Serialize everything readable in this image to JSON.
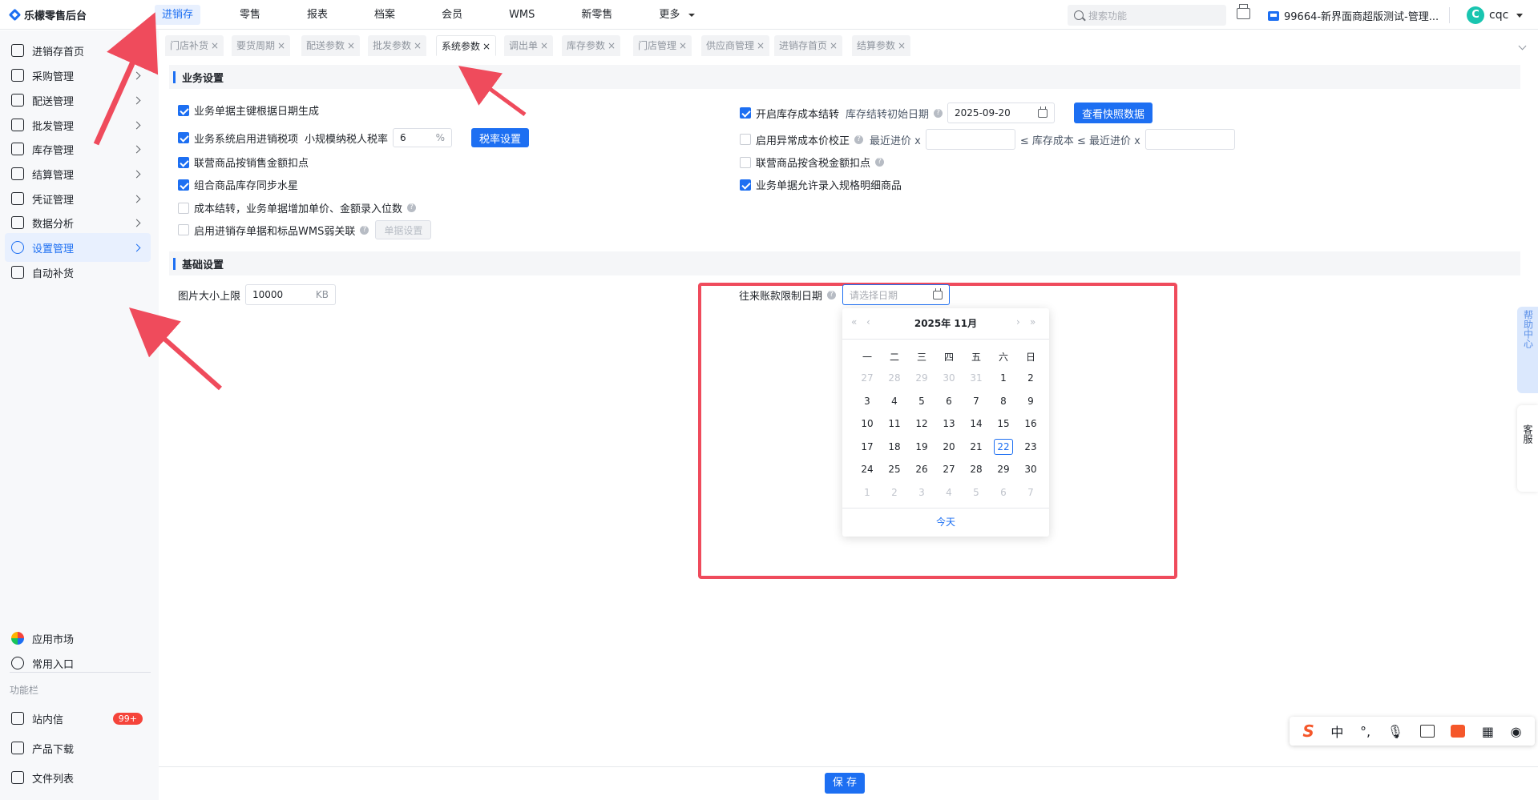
{
  "app": {
    "logo_text": "乐檬零售后台"
  },
  "topnav": [
    {
      "label": "进销存",
      "active": true
    },
    {
      "label": "零售"
    },
    {
      "label": "报表"
    },
    {
      "label": "档案"
    },
    {
      "label": "会员"
    },
    {
      "label": "WMS"
    },
    {
      "label": "新零售"
    },
    {
      "label": "更多"
    }
  ],
  "header": {
    "search_placeholder": "搜索功能",
    "store_name": "99664-新界面商超版测试-管理...",
    "user_initial": "C",
    "user_name": "cqc"
  },
  "sidebar": {
    "items": [
      {
        "label": "进销存首页",
        "icon": "home-icon"
      },
      {
        "label": "采购管理",
        "icon": "cart-icon"
      },
      {
        "label": "配送管理",
        "icon": "truck-icon"
      },
      {
        "label": "批发管理",
        "icon": "wholesale-icon"
      },
      {
        "label": "库存管理",
        "icon": "inventory-icon"
      },
      {
        "label": "结算管理",
        "icon": "settlement-icon"
      },
      {
        "label": "凭证管理",
        "icon": "voucher-icon"
      },
      {
        "label": "数据分析",
        "icon": "chart-icon"
      },
      {
        "label": "设置管理",
        "icon": "settings-icon",
        "active": true
      },
      {
        "label": "自动补货",
        "icon": "replenish-icon"
      }
    ],
    "bottom": {
      "app_market": "应用市场",
      "common_entry": "常用入口",
      "group_label": "功能栏",
      "messages": "站内信",
      "messages_badge": "99+",
      "downloads": "产品下载",
      "file_list": "文件列表"
    }
  },
  "tabs": [
    {
      "label": "门店补货"
    },
    {
      "label": "要货周期"
    },
    {
      "label": "配送参数"
    },
    {
      "label": "批发参数"
    },
    {
      "label": "系统参数",
      "active": true
    },
    {
      "label": "调出单"
    },
    {
      "label": "库存参数"
    },
    {
      "label": "门店管理"
    },
    {
      "label": "供应商管理"
    },
    {
      "label": "进销存首页"
    },
    {
      "label": "结算参数"
    }
  ],
  "business_settings": {
    "title": "业务设置",
    "left": [
      {
        "label": "业务单据主键根据日期生成",
        "checked": true
      },
      {
        "label": "业务系统启用进销税项",
        "checked": true,
        "extra_label": "小规模纳税人税率",
        "rate_value": "6",
        "rate_suffix": "%",
        "button": "税率设置"
      },
      {
        "label": "联营商品按销售金额扣点",
        "checked": true
      },
      {
        "label": "组合商品库存同步水星",
        "checked": true
      },
      {
        "label": "成本结转，业务单据增加单价、金额录入位数",
        "checked": false
      },
      {
        "label": "启用进销存单据和标品WMS弱关联",
        "checked": false,
        "button": "单据设置"
      }
    ],
    "right": [
      {
        "label": "开启库存成本结转",
        "checked": true,
        "extra_label": "库存结转初始日期",
        "date_value": "2025-09-20",
        "button": "查看快照数据"
      },
      {
        "label": "启用异常成本价校正",
        "checked": false,
        "extra_label": "最近进价 x",
        "between_label": "≤ 库存成本 ≤ 最近进价 x"
      },
      {
        "label": "联营商品按含税金额扣点",
        "checked": false
      },
      {
        "label": "业务单据允许录入规格明细商品",
        "checked": true
      }
    ]
  },
  "basic_settings": {
    "title": "基础设置",
    "image_limit_label": "图片大小上限",
    "image_limit_value": "10000",
    "image_limit_unit": "KB",
    "ar_limit_label": "往来账款限制日期",
    "ar_limit_placeholder": "请选择日期"
  },
  "calendar": {
    "title": "2025年 11月",
    "weekdays": [
      "一",
      "二",
      "三",
      "四",
      "五",
      "六",
      "日"
    ],
    "weeks": [
      [
        "27",
        "28",
        "29",
        "30",
        "31",
        "1",
        "2"
      ],
      [
        "3",
        "4",
        "5",
        "6",
        "7",
        "8",
        "9"
      ],
      [
        "10",
        "11",
        "12",
        "13",
        "14",
        "15",
        "16"
      ],
      [
        "17",
        "18",
        "19",
        "20",
        "21",
        "22",
        "23"
      ],
      [
        "24",
        "25",
        "26",
        "27",
        "28",
        "29",
        "30"
      ],
      [
        "1",
        "2",
        "3",
        "4",
        "5",
        "6",
        "7"
      ]
    ],
    "today_label": "今天",
    "selected_day": "22"
  },
  "footer": {
    "save_label": "保 存"
  },
  "float": {
    "help_center": "帮助中心",
    "customer_service": "客服"
  },
  "ime": {
    "mode_label": "中"
  },
  "colors": {
    "accent": "#1d6ff2",
    "highlight_frame": "#ef4b5c",
    "badge": "#f5443a"
  }
}
